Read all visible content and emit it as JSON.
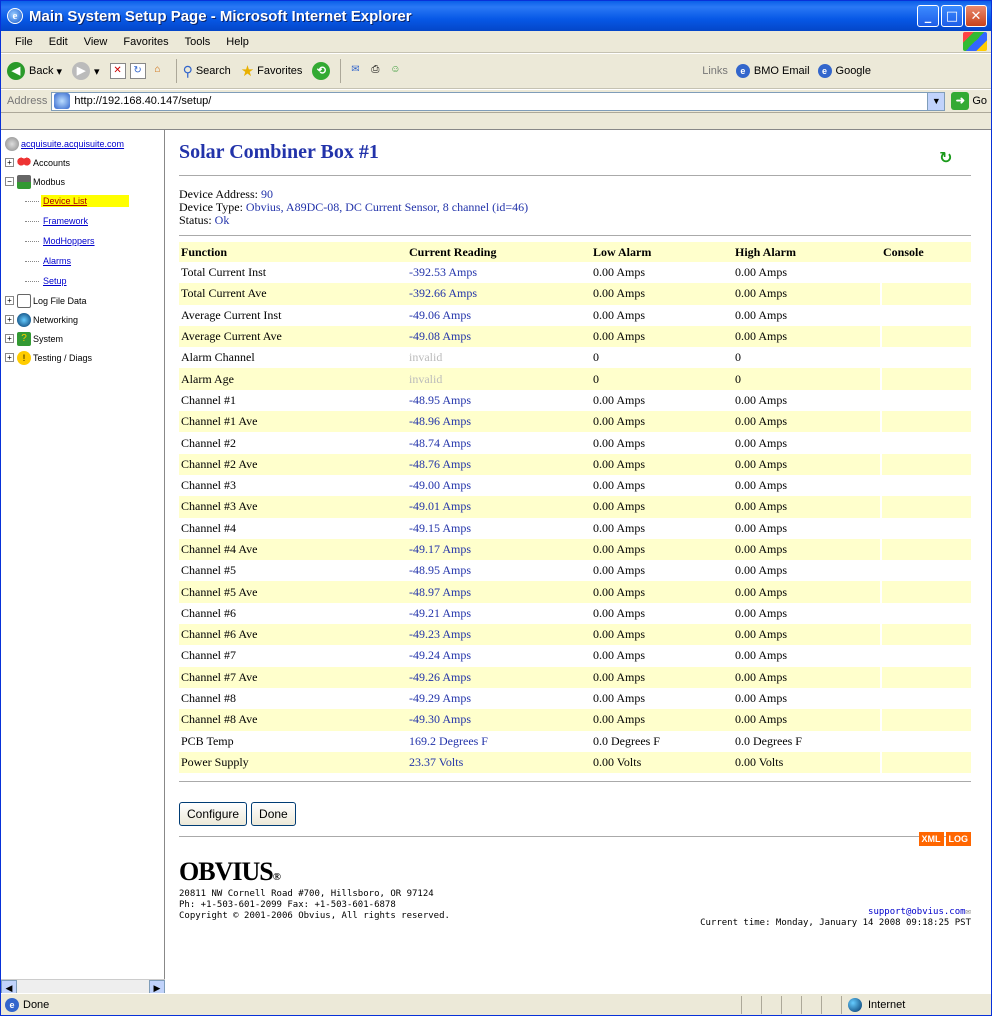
{
  "window": {
    "title": "Main System Setup Page - Microsoft Internet Explorer"
  },
  "menu": [
    "File",
    "Edit",
    "View",
    "Favorites",
    "Tools",
    "Help"
  ],
  "toolbar": {
    "back": "Back",
    "search": "Search",
    "favorites": "Favorites",
    "links_label": "Links",
    "link1": "BMO Email",
    "link2": "Google"
  },
  "address": {
    "label": "Address",
    "url": "http://192.168.40.147/setup/",
    "go": "Go"
  },
  "tree": {
    "root": "acquisuite.acquisuite.com",
    "accounts": "Accounts",
    "modbus": "Modbus",
    "device_list": "Device List",
    "framework": "Framework",
    "modhoppers": "ModHoppers",
    "alarms": "Alarms",
    "setup": "Setup",
    "logfile": "Log File Data",
    "networking": "Networking",
    "system": "System",
    "testing": "Testing / Diags"
  },
  "page": {
    "title": "Solar Combiner Box #1",
    "device_address_label": "Device Address:",
    "device_address": "90",
    "device_type_label": "Device Type:",
    "device_type": "Obvius, A89DC-08, DC Current Sensor, 8 channel (id=46)",
    "status_label": "Status:",
    "status": "Ok"
  },
  "table": {
    "headers": [
      "Function",
      "Current Reading",
      "Low Alarm",
      "High Alarm",
      "Console"
    ],
    "rows": [
      {
        "f": "Total Current Inst",
        "r": "-392.53 Amps",
        "l": "0.00 Amps",
        "h": "0.00 Amps"
      },
      {
        "f": "Total Current Ave",
        "r": "-392.66 Amps",
        "l": "0.00 Amps",
        "h": "0.00 Amps"
      },
      {
        "f": "Average Current Inst",
        "r": "-49.06 Amps",
        "l": "0.00 Amps",
        "h": "0.00 Amps"
      },
      {
        "f": "Average Current Ave",
        "r": "-49.08 Amps",
        "l": "0.00 Amps",
        "h": "0.00 Amps"
      },
      {
        "f": "Alarm Channel",
        "r": "invalid",
        "l": "0",
        "h": "0"
      },
      {
        "f": "Alarm Age",
        "r": "invalid",
        "l": "0",
        "h": "0"
      },
      {
        "f": "Channel #1",
        "r": "-48.95 Amps",
        "l": "0.00 Amps",
        "h": "0.00 Amps"
      },
      {
        "f": "Channel #1 Ave",
        "r": "-48.96 Amps",
        "l": "0.00 Amps",
        "h": "0.00 Amps"
      },
      {
        "f": "Channel #2",
        "r": "-48.74 Amps",
        "l": "0.00 Amps",
        "h": "0.00 Amps"
      },
      {
        "f": "Channel #2 Ave",
        "r": "-48.76 Amps",
        "l": "0.00 Amps",
        "h": "0.00 Amps"
      },
      {
        "f": "Channel #3",
        "r": "-49.00 Amps",
        "l": "0.00 Amps",
        "h": "0.00 Amps"
      },
      {
        "f": "Channel #3 Ave",
        "r": "-49.01 Amps",
        "l": "0.00 Amps",
        "h": "0.00 Amps"
      },
      {
        "f": "Channel #4",
        "r": "-49.15 Amps",
        "l": "0.00 Amps",
        "h": "0.00 Amps"
      },
      {
        "f": "Channel #4 Ave",
        "r": "-49.17 Amps",
        "l": "0.00 Amps",
        "h": "0.00 Amps"
      },
      {
        "f": "Channel #5",
        "r": "-48.95 Amps",
        "l": "0.00 Amps",
        "h": "0.00 Amps"
      },
      {
        "f": "Channel #5 Ave",
        "r": "-48.97 Amps",
        "l": "0.00 Amps",
        "h": "0.00 Amps"
      },
      {
        "f": "Channel #6",
        "r": "-49.21 Amps",
        "l": "0.00 Amps",
        "h": "0.00 Amps"
      },
      {
        "f": "Channel #6 Ave",
        "r": "-49.23 Amps",
        "l": "0.00 Amps",
        "h": "0.00 Amps"
      },
      {
        "f": "Channel #7",
        "r": "-49.24 Amps",
        "l": "0.00 Amps",
        "h": "0.00 Amps"
      },
      {
        "f": "Channel #7 Ave",
        "r": "-49.26 Amps",
        "l": "0.00 Amps",
        "h": "0.00 Amps"
      },
      {
        "f": "Channel #8",
        "r": "-49.29 Amps",
        "l": "0.00 Amps",
        "h": "0.00 Amps"
      },
      {
        "f": "Channel #8 Ave",
        "r": "-49.30 Amps",
        "l": "0.00 Amps",
        "h": "0.00 Amps"
      },
      {
        "f": "PCB Temp",
        "r": "169.2 Degrees F",
        "l": "0.0 Degrees F",
        "h": "0.0 Degrees F"
      },
      {
        "f": "Power Supply",
        "r": "23.37 Volts",
        "l": "0.00 Volts",
        "h": "0.00 Volts"
      }
    ]
  },
  "buttons": {
    "configure": "Configure",
    "done": "Done",
    "xml": "XML",
    "log": "LOG"
  },
  "footer": {
    "logo": "OBVIUS",
    "reg": "®",
    "line1": "20811 NW Cornell Road #700, Hillsboro, OR 97124",
    "line2": "Ph: +1-503-601-2099 Fax: +1-503-601-6878",
    "line3": "Copyright © 2001-2006 Obvius, All rights reserved.",
    "support": "support@obvius.com",
    "time": "Current time: Monday, January 14 2008 09:18:25 PST"
  },
  "statusbar": {
    "text": "Done",
    "zone": "Internet"
  },
  "colors": {
    "title_blue": "#2233aa",
    "alt_row": "#ffffcc",
    "selected": "#ffff00"
  }
}
